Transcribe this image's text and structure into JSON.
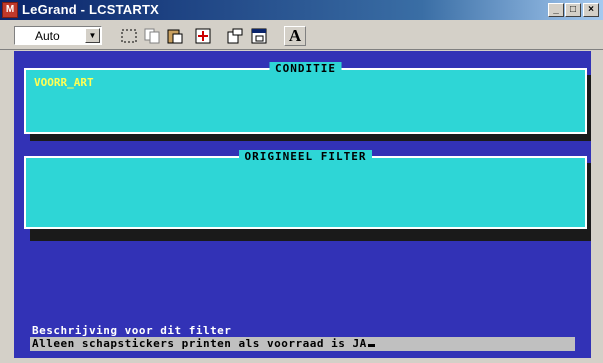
{
  "window": {
    "title": "LeGrand - LCSTARTX"
  },
  "toolbar": {
    "font_size_value": "Auto",
    "font_label": "A",
    "buttons": [
      "select-icon",
      "copy-icon",
      "paste-icon",
      "fullscreen-icon",
      "properties-icon",
      "background-icon"
    ]
  },
  "console": {
    "condition_box": {
      "title": "CONDITIE",
      "content": "VOORR_ART"
    },
    "filter_box": {
      "title": "ORIGINEEL FILTER",
      "content": ""
    },
    "description_label": "Beschrijving voor dit filter",
    "description_value": "Alleen schapstickers printen als voorraad is JA"
  },
  "colors": {
    "background": "#3232b6",
    "box": "#2ed6d6",
    "highlight_text": "#ffff55"
  }
}
